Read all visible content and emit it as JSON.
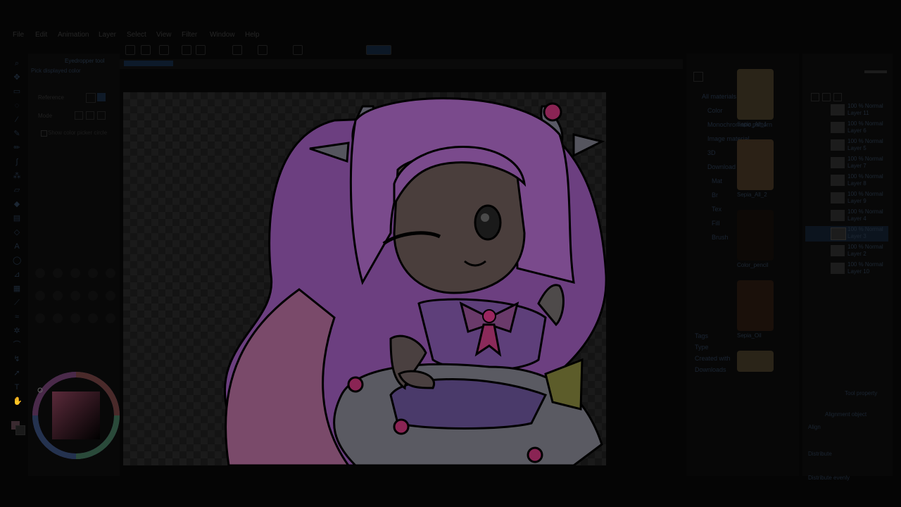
{
  "menu": [
    "File",
    "Edit",
    "Animation",
    "Layer",
    "Select",
    "View",
    "Filter",
    "Window",
    "Help"
  ],
  "toolbar_icons": [
    "new-file-icon",
    "open-icon",
    "save-icon",
    "undo-icon",
    "redo-icon",
    "clear-icon",
    "fill-icon",
    "transform-icon",
    "snap-icon"
  ],
  "sub_tool": {
    "title": "Eyedropper tool",
    "tool_name": "Pick displayed color",
    "reference_label": "Reference",
    "mode_label": "Mode",
    "checkbox_label": "Show color picker circle"
  },
  "canvas_character": {
    "hair": "#8a5a9b",
    "hair_dark": "#6e4680",
    "skin": "#4a3f3c",
    "dress": "#6e4a8f",
    "skirt_white": "#6a6a70",
    "accent": "#b0306e",
    "yellow": "#7a7a30",
    "line": "#000000"
  },
  "material_tree": [
    "All materials",
    "Color",
    "Monochromatic pattern",
    "Image material",
    "3D",
    "Download",
    "Mat",
    "Br",
    "Tex",
    "Fill",
    "Brush"
  ],
  "material_items": [
    "Sepia_All_1",
    "Sepia_All_2",
    "Color_pencil",
    "Sepia_Oil",
    "Sepia_Oil2"
  ],
  "material_filters": [
    "Tags",
    "Type",
    "Created with",
    "Downloads"
  ],
  "layers": [
    {
      "name": "Layer 11",
      "blend": "100 % Normal"
    },
    {
      "name": "Layer 6",
      "blend": "100 % Normal"
    },
    {
      "name": "Layer 5",
      "blend": "100 % Normal"
    },
    {
      "name": "Layer 7",
      "blend": "100 % Normal"
    },
    {
      "name": "Layer 8",
      "blend": "100 % Normal"
    },
    {
      "name": "Layer 9",
      "blend": "100 % Normal"
    },
    {
      "name": "Layer 4",
      "blend": "100 % Normal"
    },
    {
      "name": "Layer 3",
      "blend": "100 % Normal"
    },
    {
      "name": "Layer 2",
      "blend": "100 % Normal"
    },
    {
      "name": "Layer 10",
      "blend": "100 % Normal"
    }
  ],
  "tool_property": {
    "title": "Tool property",
    "align_label": "Align",
    "distribute_label": "Distribute",
    "distribute_evenly": "Distribute evenly",
    "target_label": "Alignment object"
  },
  "color_wheel": {
    "main": "#d87aa0",
    "sub": "#ffffff"
  }
}
